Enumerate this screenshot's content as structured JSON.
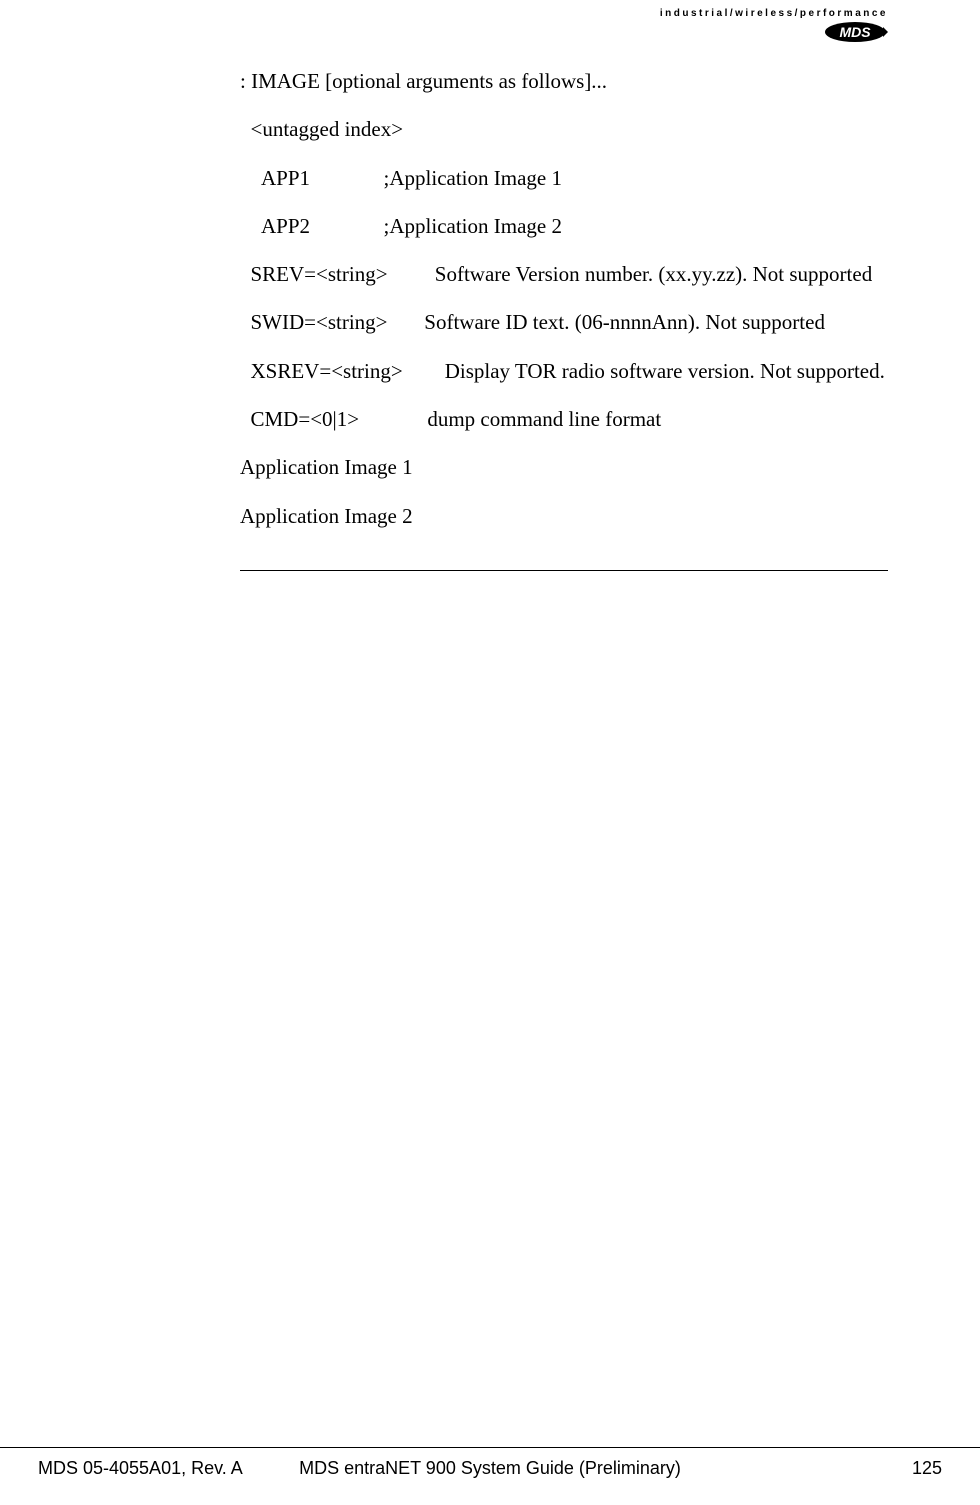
{
  "header": {
    "tagline": "industrial/wireless/performance",
    "logo_text": "MDS"
  },
  "content": {
    "line1": ": IMAGE [optional arguments as follows]...",
    "line2": "  <untagged index>",
    "line3": "    APP1              ;Application Image 1",
    "line4": "    APP2              ;Application Image 2",
    "line5": "  SREV=<string>         Software Version number. (xx.yy.zz). Not supported",
    "line6": "  SWID=<string>       Software ID text. (06-nnnnAnn). Not supported",
    "line7": "  XSREV=<string>        Display TOR radio software version. Not supported.",
    "line8": "  CMD=<0|1>             dump command line format",
    "line9": "Application Image 1",
    "line10": "Application Image 2"
  },
  "footer": {
    "left": "MDS 05-4055A01, Rev. A",
    "center": "MDS entraNET 900 System Guide (Preliminary)",
    "right": "125"
  }
}
